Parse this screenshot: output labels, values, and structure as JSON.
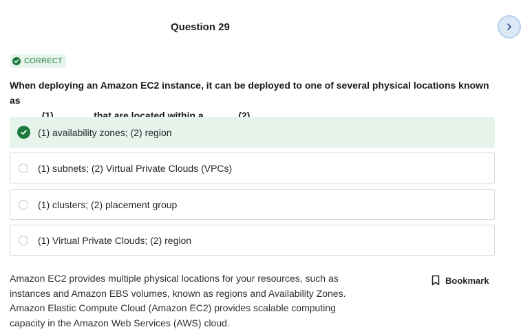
{
  "header": {
    "question_title": "Question 29",
    "next_icon": "chevron-right-icon"
  },
  "result": {
    "badge_label": "CORRECT",
    "badge_icon": "check-circle-icon",
    "color": "#1d7a3e"
  },
  "question": {
    "line1": "When deploying an Amazon EC2 instance, it can be deployed to one of several physical locations known as",
    "line2": "______(1)_______ that are located within a ______(2)______."
  },
  "options": [
    {
      "label": "(1) availability zones; (2) region",
      "selected": true
    },
    {
      "label": "(1) subnets; (2) Virtual Private Clouds (VPCs)",
      "selected": false
    },
    {
      "label": "(1) clusters; (2) placement group",
      "selected": false
    },
    {
      "label": "(1) Virtual Private Clouds; (2) region",
      "selected": false
    }
  ],
  "explanation": {
    "line1": "Amazon EC2 provides multiple physical locations for your resources, such as",
    "line2": "instances and Amazon EBS volumes, known as regions and Availability Zones.",
    "line3": "Amazon Elastic Compute Cloud (Amazon EC2) provides scalable computing",
    "line4": "capacity in the Amazon Web Services (AWS) cloud."
  },
  "bookmark": {
    "label": "Bookmark",
    "icon": "bookmark-icon"
  }
}
